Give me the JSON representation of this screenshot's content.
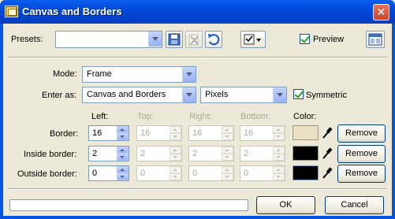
{
  "window": {
    "title": "Canvas and Borders",
    "close_glyph": "✕"
  },
  "presets": {
    "label": "Presets:",
    "value": ""
  },
  "toolbar": {
    "save_icon": "save-icon",
    "delete_icon": "delete-icon",
    "reset_icon": "undo-icon",
    "options_icon": "options-menu-icon"
  },
  "preview": {
    "label": "Preview",
    "checked": true
  },
  "mode": {
    "label": "Mode:",
    "value": "Frame"
  },
  "enter_as": {
    "label": "Enter as:",
    "value": "Canvas and Borders",
    "units": "Pixels"
  },
  "symmetric": {
    "label": "Symmetric",
    "checked": true
  },
  "columns": {
    "left": "Left:",
    "top": "Top:",
    "right": "Right:",
    "bottom": "Bottom:",
    "color": "Color:"
  },
  "rows": [
    {
      "label": "Border:",
      "left": "16",
      "top": "16",
      "right": "16",
      "bottom": "16",
      "color": "#eae0c4",
      "remove": "Remove"
    },
    {
      "label": "Inside border:",
      "left": "2",
      "top": "2",
      "right": "2",
      "bottom": "2",
      "color": "#000000",
      "remove": "Remove"
    },
    {
      "label": "Outside border:",
      "left": "0",
      "top": "0",
      "right": "0",
      "bottom": "0",
      "color": "#000000",
      "remove": "Remove"
    }
  ],
  "footer": {
    "ok": "OK",
    "cancel": "Cancel",
    "progress_percent": 0
  }
}
